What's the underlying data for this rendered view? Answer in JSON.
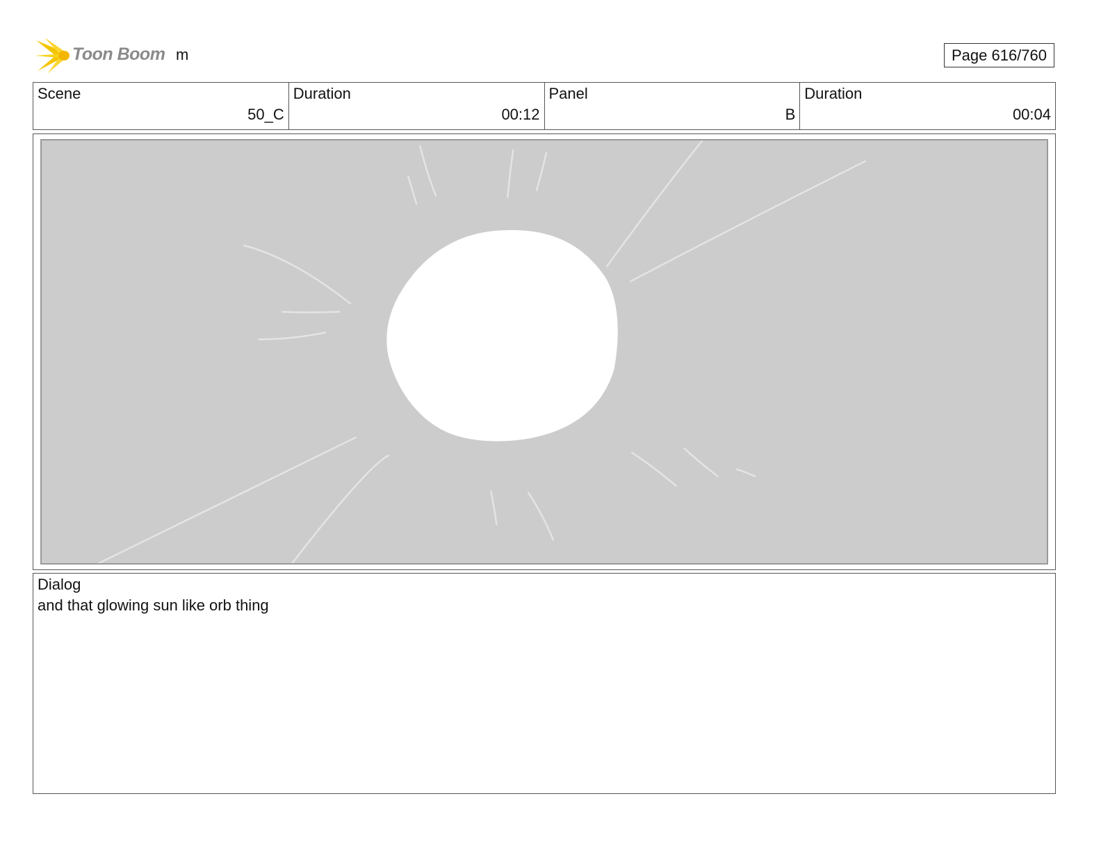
{
  "header": {
    "logo_text": "Toon Boom",
    "project_name": "m",
    "page_indicator": "Page 616/760",
    "logo_icon": "toon-boom-starburst-icon"
  },
  "info": {
    "scene_label": "Scene",
    "scene_value": "50_C",
    "scene_duration_label": "Duration",
    "scene_duration_value": "00:12",
    "panel_label": "Panel",
    "panel_value": "B",
    "panel_duration_label": "Duration",
    "panel_duration_value": "00:04"
  },
  "panel": {
    "background_color": "#cccccc",
    "orb_color": "#ffffff"
  },
  "dialog": {
    "label": "Dialog",
    "text": "and that glowing sun like orb thing"
  }
}
